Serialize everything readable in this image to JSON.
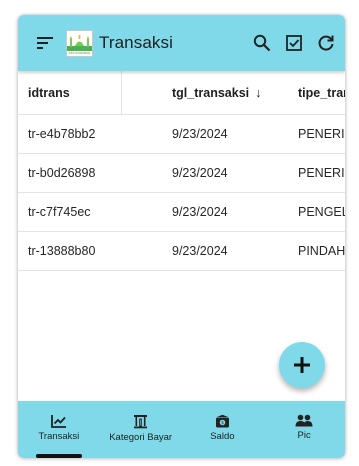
{
  "appbar": {
    "title": "Transaksi",
    "logo_caption": "ASY-SYAKIRAH",
    "menu_icon": "menu-icon",
    "actions": [
      "search-icon",
      "checkbox-icon",
      "refresh-icon"
    ],
    "color": "#7fd9e9"
  },
  "table": {
    "columns": [
      "idtrans",
      "tgl_transaksi",
      "tipe_tran"
    ],
    "sort_indicator": "↓",
    "rows": [
      [
        "tr-e4b78bb2",
        "9/23/2024",
        "PENERII"
      ],
      [
        "tr-b0d26898",
        "9/23/2024",
        "PENERII"
      ],
      [
        "tr-c7f745ec",
        "9/23/2024",
        "PENGEL"
      ],
      [
        "tr-13888b80",
        "9/23/2024",
        "PINDAH"
      ]
    ]
  },
  "fab": {
    "icon": "plus-icon"
  },
  "bottom_nav": {
    "items": [
      {
        "label": "Transaksi",
        "icon": "chart-icon",
        "active": true
      },
      {
        "label": "Kategori Bayar",
        "icon": "institution-icon",
        "active": false
      },
      {
        "label": "Saldo",
        "icon": "wallet-icon",
        "active": false
      },
      {
        "label": "Pic",
        "icon": "people-icon",
        "active": false
      }
    ]
  }
}
